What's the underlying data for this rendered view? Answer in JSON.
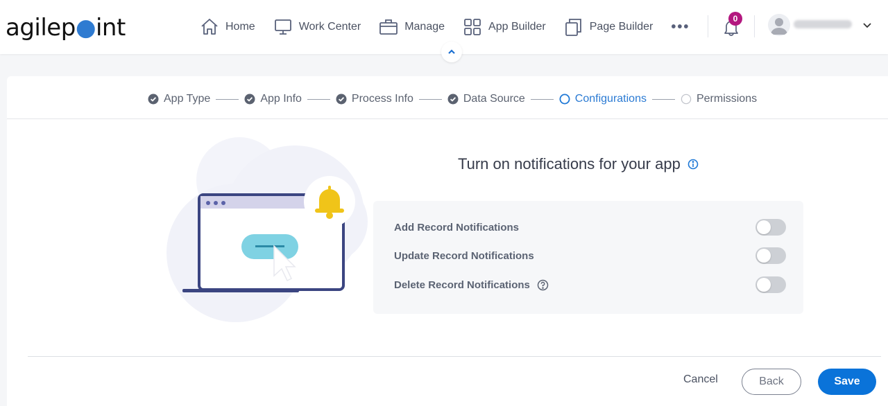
{
  "header": {
    "logo": {
      "prefix": "agilep",
      "dot": "o",
      "suffix": "int"
    },
    "nav": [
      {
        "label": "Home",
        "icon": "home-icon"
      },
      {
        "label": "Work Center",
        "icon": "monitor-icon"
      },
      {
        "label": "Manage",
        "icon": "briefcase-icon"
      },
      {
        "label": "App Builder",
        "icon": "grid-icon"
      },
      {
        "label": "Page Builder",
        "icon": "pages-icon"
      }
    ],
    "more_label": "•••",
    "notifications": {
      "count": "0",
      "icon": "bell-icon"
    },
    "user": {
      "name": "(blurred)",
      "icon": "avatar-icon"
    }
  },
  "stepper": {
    "steps": [
      {
        "label": "App Type",
        "state": "completed"
      },
      {
        "label": "App Info",
        "state": "completed"
      },
      {
        "label": "Process Info",
        "state": "completed"
      },
      {
        "label": "Data Source",
        "state": "completed"
      },
      {
        "label": "Configurations",
        "state": "active"
      },
      {
        "label": "Permissions",
        "state": "pending"
      }
    ]
  },
  "main": {
    "title": "Turn on notifications for your app",
    "options": [
      {
        "label": "Add Record Notifications",
        "enabled": false,
        "help": false
      },
      {
        "label": "Update Record Notifications",
        "enabled": false,
        "help": false
      },
      {
        "label": "Delete Record Notifications",
        "enabled": false,
        "help": true
      }
    ]
  },
  "footer": {
    "cancel_label": "Cancel",
    "back_label": "Back",
    "save_label": "Save"
  },
  "colors": {
    "accent": "#0a73d9",
    "active_step": "#2a7ad3",
    "badge": "#b3177f",
    "bell_illustration": "#f0c419"
  }
}
